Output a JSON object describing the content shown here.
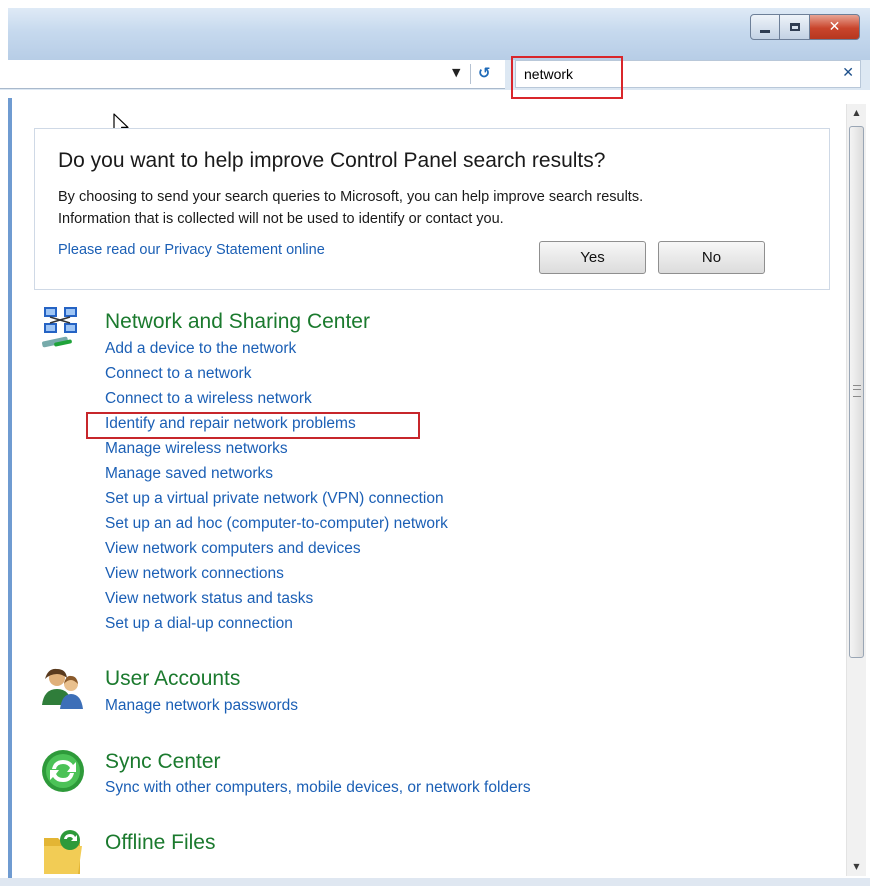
{
  "address_bar": {
    "search_value": "network"
  },
  "feedback_panel": {
    "title": "Do you want to help improve Control Panel search results?",
    "line1": "By choosing to send your search queries to Microsoft, you can help improve search results.",
    "line2": "Information that is collected will not be used to identify or contact you.",
    "privacy_link": "Please read our Privacy Statement online",
    "yes_label": "Yes",
    "no_label": "No"
  },
  "results": {
    "network": {
      "title": "Network and Sharing Center",
      "icon": "network-icon",
      "tasks": [
        "Add a device to the network",
        "Connect to a network",
        "Connect to a wireless network",
        "Identify and repair network problems",
        "Manage wireless networks",
        "Manage saved networks",
        "Set up a virtual private network (VPN) connection",
        "Set up an ad hoc (computer-to-computer) network",
        "View network computers and devices",
        "View network connections",
        "View network status and tasks",
        "Set up a dial-up connection"
      ]
    },
    "users": {
      "title": "User Accounts",
      "icon": "user-accounts-icon",
      "tasks": [
        "Manage network passwords"
      ]
    },
    "sync": {
      "title": "Sync Center",
      "icon": "sync-center-icon",
      "tasks": [
        "Sync with other computers, mobile devices, or network folders"
      ]
    },
    "offline": {
      "title": "Offline Files",
      "icon": "offline-files-icon"
    }
  },
  "colors": {
    "highlight_box": "#d9262b",
    "group_title": "#1b7a2e",
    "link": "#1b5fb5"
  }
}
